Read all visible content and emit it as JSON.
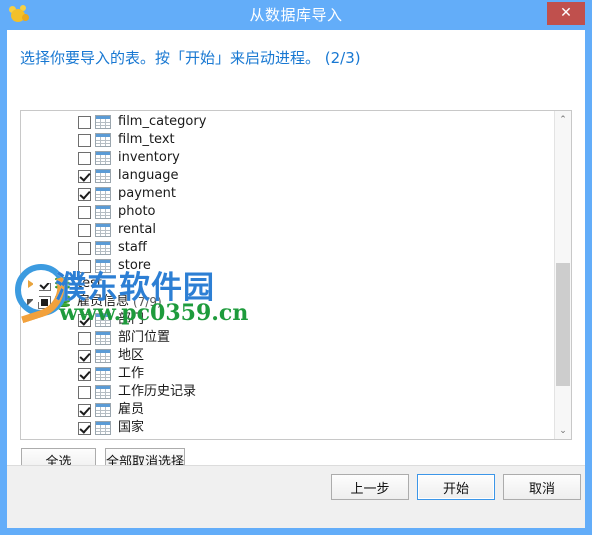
{
  "window": {
    "title": "从数据库导入",
    "app_icon": "navicat-icon",
    "close_label": "✕",
    "titlebar_color": "#63ADF9"
  },
  "header": {
    "message": "选择你要导入的表。按「开始」来启动进程。 (2/3)",
    "color": "#1878D2"
  },
  "list": {
    "items": [
      {
        "label": "film_category",
        "icon": "table-icon",
        "indent": 2,
        "checked": false,
        "twisty": "none"
      },
      {
        "label": "film_text",
        "icon": "table-icon",
        "indent": 2,
        "checked": false,
        "twisty": "none"
      },
      {
        "label": "inventory",
        "icon": "table-icon",
        "indent": 2,
        "checked": false,
        "twisty": "none"
      },
      {
        "label": "language",
        "icon": "table-icon",
        "indent": 2,
        "checked": true,
        "twisty": "none"
      },
      {
        "label": "payment",
        "icon": "table-icon",
        "indent": 2,
        "checked": true,
        "twisty": "none"
      },
      {
        "label": "photo",
        "icon": "table-icon",
        "indent": 2,
        "checked": false,
        "twisty": "none"
      },
      {
        "label": "rental",
        "icon": "table-icon",
        "indent": 2,
        "checked": false,
        "twisty": "none"
      },
      {
        "label": "staff",
        "icon": "table-icon",
        "indent": 2,
        "checked": false,
        "twisty": "none"
      },
      {
        "label": "store",
        "icon": "table-icon",
        "indent": 2,
        "checked": false,
        "twisty": "none"
      },
      {
        "label": "test",
        "icon": "database-icon",
        "indent": 0,
        "checked": true,
        "twisty": "collapsed"
      },
      {
        "label": "雇员信息",
        "icon": "database-icon",
        "indent": 0,
        "checked": "partial",
        "twisty": "expanded",
        "count": "(7/9)"
      },
      {
        "label": "部门",
        "icon": "table-icon",
        "indent": 2,
        "checked": true,
        "twisty": "none"
      },
      {
        "label": "部门位置",
        "icon": "table-icon",
        "indent": 2,
        "checked": false,
        "twisty": "none"
      },
      {
        "label": "地区",
        "icon": "table-icon",
        "indent": 2,
        "checked": true,
        "twisty": "none"
      },
      {
        "label": "工作",
        "icon": "table-icon",
        "indent": 2,
        "checked": true,
        "twisty": "none"
      },
      {
        "label": "工作历史记录",
        "icon": "table-icon",
        "indent": 2,
        "checked": false,
        "twisty": "none"
      },
      {
        "label": "雇员",
        "icon": "table-icon",
        "indent": 2,
        "checked": true,
        "twisty": "none"
      },
      {
        "label": "国家",
        "icon": "table-icon",
        "indent": 2,
        "checked": true,
        "twisty": "none"
      }
    ],
    "scrollbar": {
      "up_arrow": "⌃",
      "down_arrow": "⌄"
    }
  },
  "selection_buttons": {
    "select_all": "全选",
    "deselect_all": "全部取消选择"
  },
  "footer_buttons": {
    "previous": "上一步",
    "start": "开始",
    "cancel": "取消"
  },
  "watermark": {
    "text_cn": "濮东软件园",
    "url": "www.pc0359.cn"
  }
}
